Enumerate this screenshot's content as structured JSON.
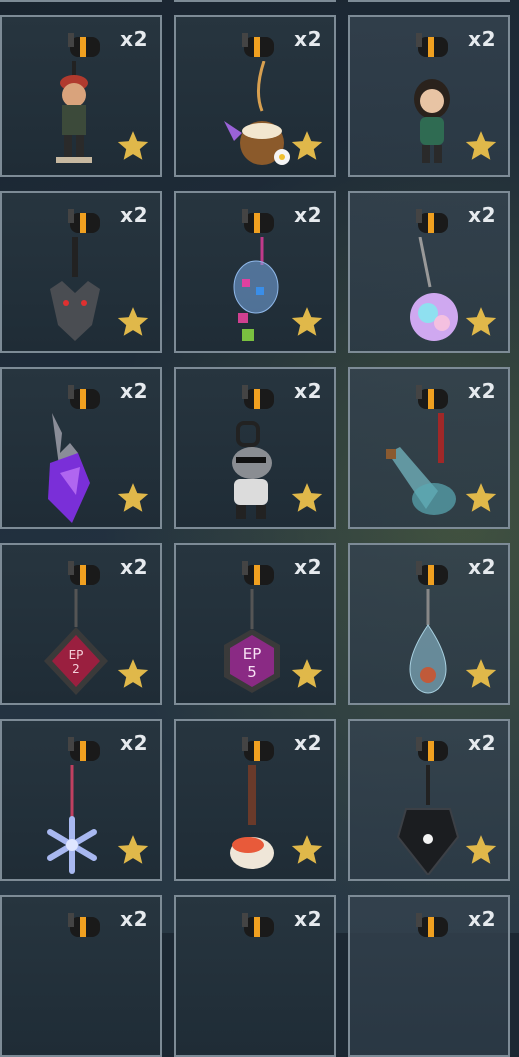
{
  "grid": {
    "rows": [
      {
        "items": [
          {
            "name": "soldier-figurine-charm",
            "qty": "x2",
            "star": "gold-star-icon"
          },
          {
            "name": "coconut-drink-charm",
            "qty": "x2",
            "star": "gold-star-icon"
          },
          {
            "name": "agent-figurine-charm",
            "qty": "x2",
            "star": "gold-star-icon"
          }
        ]
      },
      {
        "items": [
          {
            "name": "wolf-head-charm",
            "qty": "x2",
            "star": "gold-star-icon"
          },
          {
            "name": "candy-bag-charm",
            "qty": "x2",
            "star": "gold-star-icon"
          },
          {
            "name": "holo-face-charm",
            "qty": "x2",
            "star": "gold-star-icon"
          }
        ]
      },
      {
        "items": [
          {
            "name": "purple-blade-charm",
            "qty": "x2",
            "star": "gold-star-icon"
          },
          {
            "name": "rhino-figurine-charm",
            "qty": "x2",
            "star": "gold-star-icon"
          },
          {
            "name": "potion-bottle-charm",
            "qty": "x2",
            "star": "gold-star-icon"
          }
        ]
      },
      {
        "items": [
          {
            "name": "ep2-badge-charm",
            "qty": "x2",
            "badge": "EP\n2",
            "star": "gold-star-icon"
          },
          {
            "name": "ep5-badge-charm",
            "qty": "x2",
            "badge": "EP\n5",
            "star": "gold-star-icon"
          },
          {
            "name": "water-droplet-charm",
            "qty": "x2",
            "star": "gold-star-icon"
          }
        ]
      },
      {
        "items": [
          {
            "name": "snowflake-charm",
            "qty": "x2",
            "star": "gold-star-icon"
          },
          {
            "name": "sushi-charm",
            "qty": "x2",
            "star": "gold-star-icon"
          },
          {
            "name": "black-crystal-charm",
            "qty": "x2",
            "star": "gold-star-icon"
          }
        ]
      },
      {
        "items": [
          {
            "name": "partial-charm-1",
            "qty": "x2"
          },
          {
            "name": "partial-charm-2",
            "qty": "x2"
          },
          {
            "name": "partial-charm-3",
            "qty": "x2"
          }
        ]
      }
    ],
    "badges": {
      "ep2_line1": "EP",
      "ep2_line2": "2",
      "ep5_line1": "EP",
      "ep5_line2": "5"
    }
  },
  "colors": {
    "tile_border": "#7d8b96",
    "star_gold": "#e0b84a",
    "clip_orange": "#f0a020",
    "background": "#1c2833"
  }
}
